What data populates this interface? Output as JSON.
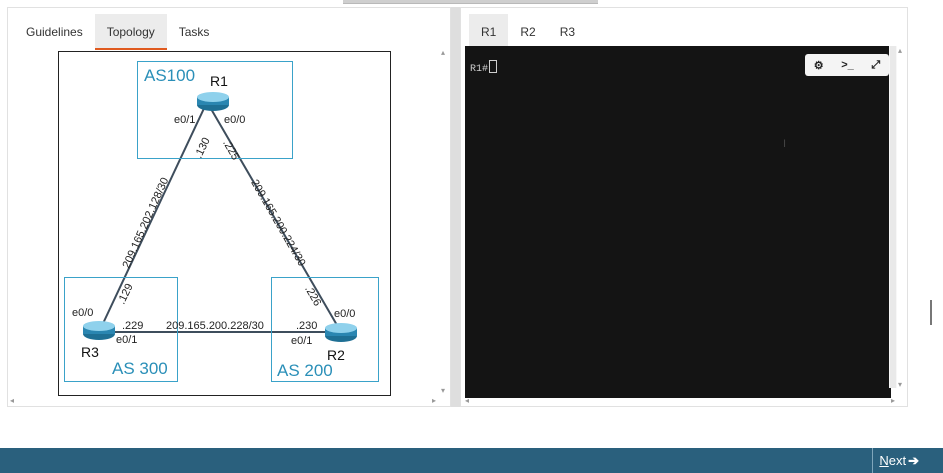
{
  "left_panel": {
    "tabs": [
      {
        "label": "Guidelines",
        "active": false
      },
      {
        "label": "Topology",
        "active": true
      },
      {
        "label": "Tasks",
        "active": false
      }
    ]
  },
  "topology": {
    "as_boxes": {
      "as100": "AS100",
      "as300": "AS 300",
      "as200": "AS 200"
    },
    "routers": {
      "r1": "R1",
      "r2": "R2",
      "r3": "R3"
    },
    "interfaces": {
      "r1_e01": "e0/1",
      "r1_e00": "e0/0",
      "r3_e00": "e0/0",
      "r3_e01": "e0/1",
      "r2_e00": "e0/0",
      "r2_e01": "e0/1"
    },
    "host_ips": {
      "r1_130": ".130",
      "r1_225": ".225",
      "r3_129": ".129",
      "r3_229": ".229",
      "r2_226": ".226",
      "r2_230": ".230"
    },
    "links": {
      "r1_r3": "209.165.202.128/30",
      "r1_r2": "209.165.200.224/30",
      "r3_r2": "209.165.200.228/30"
    }
  },
  "right_panel": {
    "tabs": [
      {
        "label": "R1",
        "active": true
      },
      {
        "label": "R2",
        "active": false
      },
      {
        "label": "R3",
        "active": false
      }
    ],
    "terminal": {
      "prompt": "R1#",
      "toolbar": [
        "settings-icon",
        "terminal-icon",
        "fullscreen-icon"
      ]
    }
  },
  "footer": {
    "next_label_underlined": "N",
    "next_label_rest": "ext",
    "next_icon": "arrow-right-icon"
  },
  "colors": {
    "accent_tab": "#e05a1f",
    "as_box": "#3aa2c9",
    "footer": "#2a607d",
    "terminal_bg": "#141414"
  }
}
